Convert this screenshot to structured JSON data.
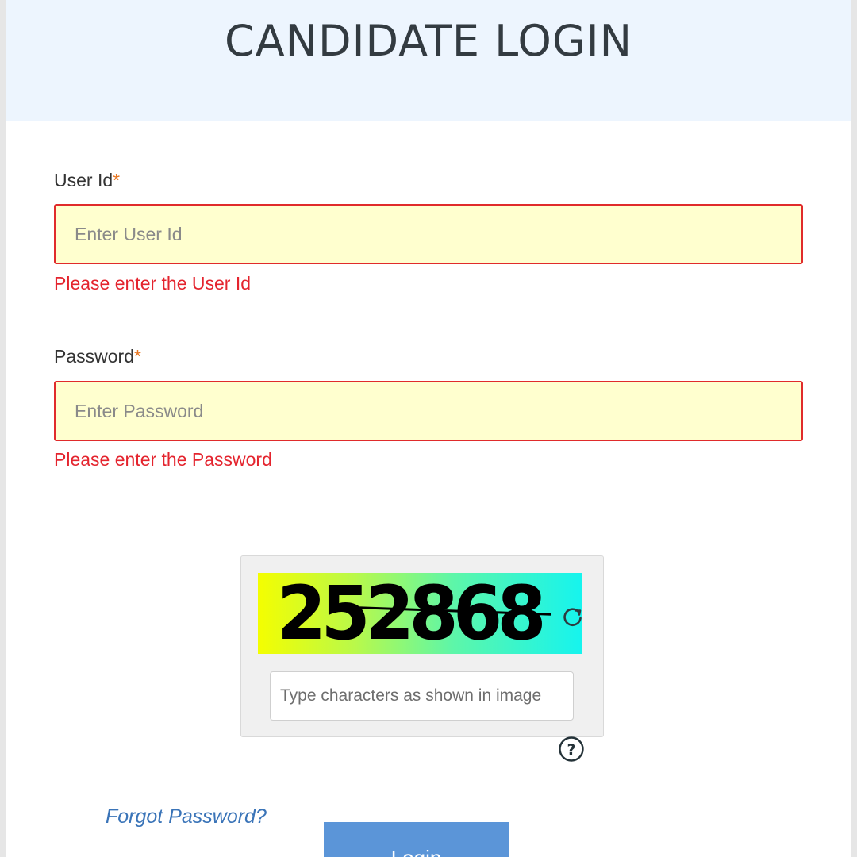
{
  "header": {
    "title": "CANDIDATE LOGIN"
  },
  "form": {
    "user_id": {
      "label": "User Id",
      "required_mark": "*",
      "value": "",
      "placeholder": "Enter User Id",
      "error": "Please enter the User Id"
    },
    "password": {
      "label": "Password",
      "required_mark": "*",
      "value": "",
      "placeholder": "Enter Password",
      "error": "Please enter the Password"
    }
  },
  "captcha": {
    "image_text": "252868",
    "input_value": "",
    "input_placeholder": "Type characters as shown in image",
    "refresh_icon": "refresh-icon",
    "help_icon": "question-circle-icon",
    "gradient_colors": [
      "#f4fe00",
      "#16f4ee"
    ]
  },
  "actions": {
    "forgot_password": "Forgot Password?",
    "login_label": "Login"
  },
  "colors": {
    "header_bg": "#edf5fe",
    "input_bg": "#ffffcf",
    "error_red": "#e4242e",
    "required_orange": "#e87722",
    "link_blue": "#3a74b8",
    "button_blue": "#5b95d8"
  }
}
